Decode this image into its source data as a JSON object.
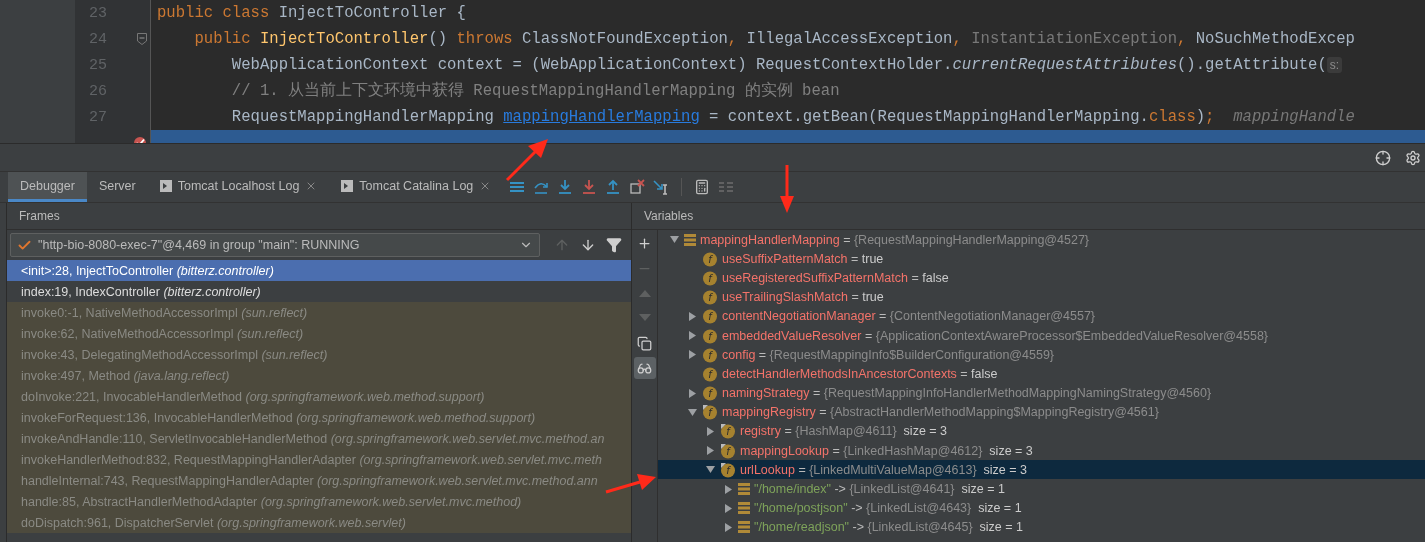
{
  "editor": {
    "lines": [
      {
        "number": "23",
        "fold": false,
        "breakpoint": false,
        "current": false,
        "segments": [
          {
            "kind": "keyword",
            "text": "public class "
          },
          {
            "kind": "plain",
            "text": "InjectToController {"
          }
        ]
      },
      {
        "number": "24",
        "fold": true,
        "breakpoint": false,
        "current": false,
        "segments": [
          {
            "kind": "keyword",
            "text": "    public "
          },
          {
            "kind": "method",
            "text": "InjectToController"
          },
          {
            "kind": "plain",
            "text": "() "
          },
          {
            "kind": "keyword",
            "text": "throws "
          },
          {
            "kind": "plain",
            "text": "ClassNotFoundException"
          },
          {
            "kind": "keyword",
            "text": ", "
          },
          {
            "kind": "plain",
            "text": "IllegalAccessException"
          },
          {
            "kind": "keyword",
            "text": ", "
          },
          {
            "kind": "muted",
            "text": "InstantiationException"
          },
          {
            "kind": "keyword",
            "text": ", "
          },
          {
            "kind": "plain",
            "text": "NoSuchMethodExcep"
          }
        ]
      },
      {
        "number": "25",
        "fold": false,
        "breakpoint": false,
        "current": false,
        "segments": [
          {
            "kind": "plain",
            "text": "        WebApplicationContext context = (WebApplicationContext) RequestContextHolder."
          },
          {
            "kind": "static",
            "text": "currentRequestAttributes"
          },
          {
            "kind": "plain",
            "text": "().getAttribute("
          },
          {
            "kind": "inlay",
            "text": "s:"
          }
        ]
      },
      {
        "number": "26",
        "fold": false,
        "breakpoint": false,
        "current": false,
        "segments": [
          {
            "kind": "comment",
            "text": "        // 1. 从当前上下文环境中获得 RequestMappingHandlerMapping 的实例 bean"
          }
        ]
      },
      {
        "number": "27",
        "fold": false,
        "breakpoint": false,
        "current": false,
        "segments": [
          {
            "kind": "plain",
            "text": "        RequestMappingHandlerMapping "
          },
          {
            "kind": "link",
            "text": "mappingHandlerMapping"
          },
          {
            "kind": "plain",
            "text": " = context.getBean(RequestMappingHandlerMapping."
          },
          {
            "kind": "keyword",
            "text": "class"
          },
          {
            "kind": "plain",
            "text": ")"
          },
          {
            "kind": "keyword",
            "text": ";"
          },
          {
            "kind": "hint",
            "text": "  mappingHandle"
          }
        ]
      },
      {
        "fold": false,
        "breakpoint": true,
        "current": true
      }
    ]
  },
  "tool_strip": [
    {
      "kind": "crosshair"
    },
    {
      "kind": "settings"
    }
  ],
  "tabs": [
    {
      "label": "Debugger",
      "kind": "view",
      "selected": true
    },
    {
      "label": "Server",
      "kind": "view",
      "selected": false
    },
    {
      "label": "Tomcat Localhost Log",
      "kind": "log",
      "selected": false
    },
    {
      "label": "Tomcat Catalina Log",
      "kind": "log",
      "selected": false
    }
  ],
  "debug_toolbar": [
    {
      "kind": "show-execution-point",
      "disabled": false
    },
    {
      "kind": "step-over",
      "disabled": false
    },
    {
      "kind": "step-into",
      "disabled": false
    },
    {
      "kind": "force-step-into",
      "disabled": false
    },
    {
      "kind": "step-out",
      "disabled": false
    },
    {
      "kind": "drop-frame",
      "disabled": false
    },
    {
      "kind": "run-to-cursor",
      "disabled": false
    },
    {
      "kind": "evaluate",
      "disabled": false
    },
    {
      "kind": "trace",
      "disabled": true
    }
  ],
  "frames": {
    "title": "Frames",
    "thread": {
      "label": "\"http-bio-8080-exec-7\"@4,469 in group \"main\": RUNNING",
      "running": true
    },
    "toolbar": [
      {
        "kind": "up",
        "disabled": true
      },
      {
        "kind": "down",
        "disabled": false
      },
      {
        "kind": "filter",
        "disabled": false
      }
    ],
    "items": [
      {
        "method": "<init>:28, InjectToController",
        "location": "(bitterz.controller)",
        "kind": "app",
        "selected": true
      },
      {
        "method": "index:19, IndexController",
        "location": "(bitterz.controller)",
        "kind": "app",
        "selected": false
      },
      {
        "method": "invoke0:-1, NativeMethodAccessorImpl",
        "location": "(sun.reflect)",
        "kind": "library",
        "selected": false
      },
      {
        "method": "invoke:62, NativeMethodAccessorImpl",
        "location": "(sun.reflect)",
        "kind": "library",
        "selected": false
      },
      {
        "method": "invoke:43, DelegatingMethodAccessorImpl",
        "location": "(sun.reflect)",
        "kind": "library",
        "selected": false
      },
      {
        "method": "invoke:497, Method",
        "location": "(java.lang.reflect)",
        "kind": "library",
        "selected": false
      },
      {
        "method": "doInvoke:221, InvocableHandlerMethod",
        "location": "(org.springframework.web.method.support)",
        "kind": "library",
        "selected": false
      },
      {
        "method": "invokeForRequest:136, InvocableHandlerMethod",
        "location": "(org.springframework.web.method.support)",
        "kind": "library",
        "selected": false
      },
      {
        "method": "invokeAndHandle:110, ServletInvocableHandlerMethod",
        "location": "(org.springframework.web.servlet.mvc.method.an",
        "kind": "library",
        "selected": false
      },
      {
        "method": "invokeHandlerMethod:832, RequestMappingHandlerAdapter",
        "location": "(org.springframework.web.servlet.mvc.meth",
        "kind": "library",
        "selected": false
      },
      {
        "method": "handleInternal:743, RequestMappingHandlerAdapter",
        "location": "(org.springframework.web.servlet.mvc.method.ann",
        "kind": "library",
        "selected": false
      },
      {
        "method": "handle:85, AbstractHandlerMethodAdapter",
        "location": "(org.springframework.web.servlet.mvc.method)",
        "kind": "library",
        "selected": false
      },
      {
        "method": "doDispatch:961, DispatcherServlet",
        "location": "(org.springframework.web.servlet)",
        "kind": "library",
        "selected": false
      }
    ]
  },
  "variables": {
    "title": "Variables",
    "toolbar": [
      {
        "kind": "add",
        "disabled": false,
        "selected": false
      },
      {
        "kind": "remove",
        "disabled": true,
        "selected": false
      },
      {
        "kind": "move-up",
        "disabled": true,
        "selected": false
      },
      {
        "kind": "move-down",
        "disabled": true,
        "selected": false
      },
      {
        "kind": "copy",
        "disabled": false,
        "selected": false
      },
      {
        "kind": "watches",
        "disabled": false,
        "selected": true
      }
    ],
    "items": [
      {
        "kind": "local",
        "name": "mappingHandlerMapping",
        "operator": " = ",
        "value": "{RequestMappingHandlerMapping@4527}",
        "reference": true,
        "expandable": true,
        "expanded": true,
        "marked": false,
        "selected": false,
        "children": [
          {
            "kind": "field",
            "badge": "f",
            "name": "useSuffixPatternMatch",
            "operator": " = ",
            "value": "true",
            "reference": false,
            "expandable": false,
            "expanded": false,
            "marked": false,
            "selected": false
          },
          {
            "kind": "field",
            "badge": "f",
            "name": "useRegisteredSuffixPatternMatch",
            "operator": " = ",
            "value": "false",
            "reference": false,
            "expandable": false,
            "expanded": false,
            "marked": false,
            "selected": false
          },
          {
            "kind": "field",
            "badge": "f",
            "name": "useTrailingSlashMatch",
            "operator": " = ",
            "value": "true",
            "reference": false,
            "expandable": false,
            "expanded": false,
            "marked": false,
            "selected": false
          },
          {
            "kind": "field",
            "badge": "f",
            "name": "contentNegotiationManager",
            "operator": " = ",
            "value": "{ContentNegotiationManager@4557}",
            "reference": true,
            "expandable": true,
            "expanded": false,
            "marked": false,
            "selected": false
          },
          {
            "kind": "field",
            "badge": "f",
            "name": "embeddedValueResolver",
            "operator": " = ",
            "value": "{ApplicationContextAwareProcessor$EmbeddedValueResolver@4558}",
            "reference": true,
            "expandable": true,
            "expanded": false,
            "marked": false,
            "selected": false
          },
          {
            "kind": "field",
            "badge": "f",
            "name": "config",
            "operator": " = ",
            "value": "{RequestMappingInfo$BuilderConfiguration@4559}",
            "reference": true,
            "expandable": true,
            "expanded": false,
            "marked": false,
            "selected": false
          },
          {
            "kind": "field",
            "badge": "f",
            "name": "detectHandlerMethodsInAncestorContexts",
            "operator": " = ",
            "value": "false",
            "reference": false,
            "expandable": false,
            "expanded": false,
            "marked": false,
            "selected": false
          },
          {
            "kind": "field",
            "badge": "f",
            "name": "namingStrategy",
            "operator": " = ",
            "value": "{RequestMappingInfoHandlerMethodMappingNamingStrategy@4560}",
            "reference": true,
            "expandable": true,
            "expanded": false,
            "marked": false,
            "selected": false
          },
          {
            "kind": "field",
            "badge": "f",
            "name": "mappingRegistry",
            "operator": " = ",
            "value": "{AbstractHandlerMethodMapping$MappingRegistry@4561}",
            "reference": true,
            "expandable": true,
            "expanded": true,
            "marked": true,
            "selected": false,
            "children": [
              {
                "kind": "field",
                "badge": "f",
                "name": "registry",
                "operator": " = ",
                "value": "{HashMap@4611}",
                "reference": true,
                "size": "size = 3",
                "expandable": true,
                "expanded": false,
                "marked": true,
                "selected": false
              },
              {
                "kind": "field",
                "badge": "f",
                "name": "mappingLookup",
                "operator": " = ",
                "value": "{LinkedHashMap@4612}",
                "reference": true,
                "size": "size = 3",
                "expandable": true,
                "expanded": false,
                "marked": true,
                "selected": false
              },
              {
                "kind": "field",
                "badge": "f",
                "name": "urlLookup",
                "operator": " = ",
                "value": "{LinkedMultiValueMap@4613}",
                "reference": true,
                "size": "size = 3",
                "expandable": true,
                "expanded": true,
                "marked": true,
                "selected": true,
                "children": [
                  {
                    "kind": "entry",
                    "name": "\"/home/index\"",
                    "operator": " -> ",
                    "value": "{LinkedList@4641}",
                    "reference": true,
                    "size": "size = 1",
                    "expandable": true,
                    "expanded": false,
                    "marked": false,
                    "selected": false
                  },
                  {
                    "kind": "entry",
                    "name": "\"/home/postjson\"",
                    "operator": " -> ",
                    "value": "{LinkedList@4643}",
                    "reference": true,
                    "size": "size = 1",
                    "expandable": true,
                    "expanded": false,
                    "marked": false,
                    "selected": false
                  },
                  {
                    "kind": "entry",
                    "name": "\"/home/readjson\"",
                    "operator": " -> ",
                    "value": "{LinkedList@4645}",
                    "reference": true,
                    "size": "size = 1",
                    "expandable": true,
                    "expanded": false,
                    "marked": false,
                    "selected": false
                  }
                ]
              }
            ]
          }
        ]
      }
    ]
  }
}
